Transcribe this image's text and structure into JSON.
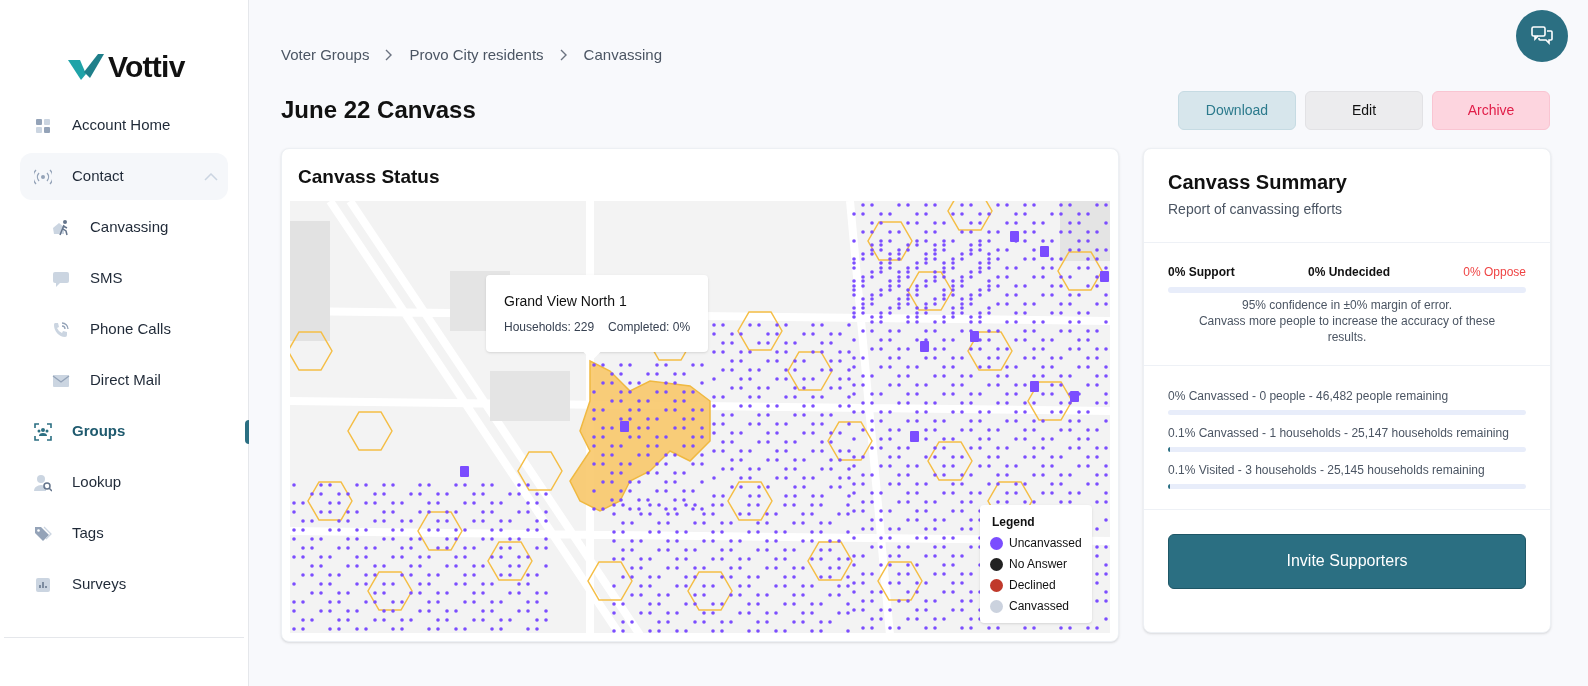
{
  "logo": {
    "text": "Vottiv"
  },
  "sidebar": {
    "items": [
      {
        "label": "Account Home",
        "kind": "home",
        "selected": false
      },
      {
        "label": "Contact",
        "kind": "contact",
        "selected": false,
        "expanded": true,
        "children": [
          {
            "label": "Canvassing",
            "kind": "canvassing",
            "selected": false
          },
          {
            "label": "SMS",
            "kind": "sms",
            "selected": false
          },
          {
            "label": "Phone Calls",
            "kind": "calls",
            "selected": false
          },
          {
            "label": "Direct Mail",
            "kind": "mail",
            "selected": false
          }
        ]
      },
      {
        "label": "Groups",
        "kind": "groups",
        "selected": true
      },
      {
        "label": "Lookup",
        "kind": "lookup",
        "selected": false
      },
      {
        "label": "Tags",
        "kind": "tags",
        "selected": false
      },
      {
        "label": "Surveys",
        "kind": "surveys",
        "selected": false
      }
    ]
  },
  "breadcrumb": [
    "Voter Groups",
    "Provo City residents",
    "Canvassing"
  ],
  "page_title": "June 22 Canvass",
  "actions": [
    {
      "label": "Download",
      "kind": "download"
    },
    {
      "label": "Edit",
      "kind": "edit"
    },
    {
      "label": "Archive",
      "kind": "archive"
    }
  ],
  "status_card": {
    "title": "Canvass Status",
    "tooltip": {
      "title": "Grand View North 1",
      "households": "Households: 229",
      "completed": "Completed: 0%"
    },
    "legend": {
      "title": "Legend",
      "items": [
        {
          "label": "Uncanvassed",
          "color": "#7b4dff"
        },
        {
          "label": "No Answer",
          "color": "#222222"
        },
        {
          "label": "Declined",
          "color": "#c0392b"
        },
        {
          "label": "Canvassed",
          "color": "#cbd2de"
        }
      ]
    }
  },
  "summary_card": {
    "title": "Canvass Summary",
    "subtitle": "Report of canvassing efforts",
    "support": "0% Support",
    "undecided": "0% Undecided",
    "oppose": "0% Oppose",
    "level": 0,
    "note": "95% confidence in ±0% margin of error.\nCanvass more people to increase the accuracy of these results.",
    "progress": [
      {
        "text": "0% Canvassed - 0 people - 46,482 people remaining",
        "level": 0
      },
      {
        "text": "0.1% Canvassed - 1 households - 25,147 households remaining",
        "level": 0.001
      },
      {
        "text": "0.1% Visited - 3 households - 25,145 households remaining",
        "level": 0.001
      }
    ],
    "button": "Invite Supporters"
  }
}
